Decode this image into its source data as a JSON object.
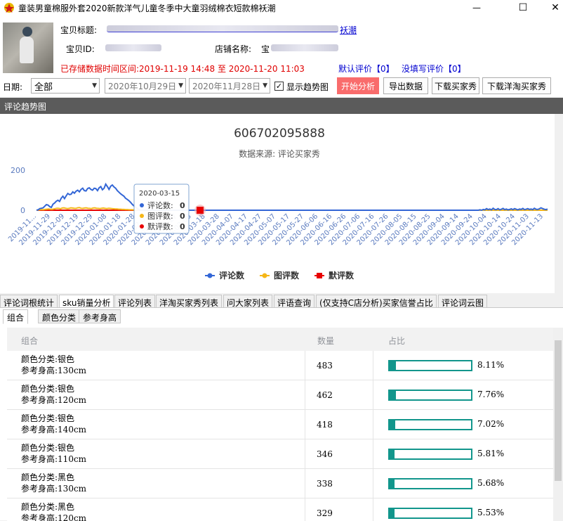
{
  "window": {
    "title": "童装男童棉服外套2020新款洋气儿童冬季中大童羽绒棉衣短款棉袄潮",
    "minimize": "—",
    "maximize": "☐",
    "close": "✕"
  },
  "product": {
    "title_label": "宝贝标题:",
    "title_value_tail": "袄潮",
    "id_label": "宝贝ID:",
    "shop_label": "店铺名称:",
    "shop_value_head": "宝",
    "stored_range_label": "已存储数据时间区间:",
    "stored_range_value": "2019-11-19 14:48 至 2020-11-20 11:03",
    "default_reviews": "默认评价【0】",
    "no_review": "没填写评价【0】"
  },
  "toolbar": {
    "date_label": "日期:",
    "range_select": "全部",
    "start_date": "2020年10月29日",
    "end_date": "2020年11月28日",
    "show_trend_label": "显示趋势图",
    "show_trend_checked": true,
    "analyze_btn": "开始分析",
    "export_btn": "导出数据",
    "download_buyer_btn": "下载买家秀",
    "download_global_btn": "下载洋淘买家秀"
  },
  "section_title": "评论趋势图",
  "chart_data": {
    "type": "line",
    "title": "606702095888",
    "subtitle": "数据来源: 评论买家秀",
    "ylim": [
      0,
      200
    ],
    "yticks": [
      "200",
      "0"
    ],
    "xticks": [
      "2019-11...",
      "2019-11-29",
      "2019-12-09",
      "2019-12-19",
      "2019-12-29",
      "2020-01-08",
      "2020-01-18",
      "2020-01-28",
      "2020-02-07",
      "2020-02-17",
      "2020-02-27",
      "2020-03-08",
      "2020-03-18",
      "2020-03-28",
      "2020-04-07",
      "2020-04-17",
      "2020-04-27",
      "2020-05-07",
      "2020-05-17",
      "2020-05-27",
      "2020-06-06",
      "2020-06-16",
      "2020-06-26",
      "2020-07-06",
      "2020-07-16",
      "2020-07-26",
      "2020-08-05",
      "2020-08-15",
      "2020-08-25",
      "2020-09-04",
      "2020-09-14",
      "2020-09-24",
      "2020-10-04",
      "2020-10-14",
      "2020-10-24",
      "2020-11-03",
      "2020-11-13"
    ],
    "series": [
      {
        "name": "评论数",
        "color": "#3366d6",
        "values": [
          0,
          2,
          8,
          10,
          12,
          20,
          28,
          26,
          18,
          14,
          30,
          36,
          45,
          50,
          44,
          60,
          70,
          58,
          72,
          84,
          78,
          80,
          92,
          85,
          95,
          100,
          92,
          104,
          110,
          98,
          96,
          108,
          112,
          104,
          100,
          110,
          108,
          98,
          112,
          118,
          102,
          110,
          130,
          118,
          104,
          120,
          126,
          116,
          110,
          98,
          90,
          82,
          76,
          70,
          60,
          54,
          48,
          40,
          30,
          22,
          16,
          10,
          4,
          0,
          0,
          0,
          0,
          0,
          0,
          0,
          0,
          0,
          0,
          0,
          0,
          0,
          0,
          0,
          0,
          0,
          0,
          0,
          0,
          0,
          0,
          0,
          0,
          0,
          0,
          0,
          0,
          0,
          0,
          0,
          0,
          0,
          0,
          0,
          0,
          0,
          0,
          0,
          0,
          0,
          0,
          0,
          0,
          0,
          0,
          0,
          0,
          0,
          0,
          0,
          0,
          0,
          0,
          0,
          0,
          0,
          0,
          0,
          0,
          0,
          0,
          0,
          0,
          0,
          0,
          0,
          0,
          0,
          0,
          0,
          0,
          0,
          0,
          0,
          0,
          0,
          0,
          0,
          0,
          0,
          0,
          0,
          0,
          0,
          0,
          0,
          0,
          0,
          0,
          0,
          0,
          0,
          0,
          0,
          0,
          0,
          0,
          0,
          0,
          0,
          0,
          0,
          0,
          0,
          0,
          0,
          0,
          0,
          0,
          0,
          0,
          0,
          0,
          0,
          0,
          0,
          0,
          0,
          0,
          0,
          0,
          0,
          0,
          0,
          0,
          0,
          0,
          0,
          0,
          0,
          0,
          0,
          0,
          0,
          0,
          0,
          0,
          0,
          0,
          0,
          0,
          0,
          0,
          0,
          0,
          0,
          0,
          0,
          0,
          0,
          0,
          0,
          0,
          0,
          0,
          0,
          0,
          0,
          0,
          0,
          0,
          0,
          0,
          0,
          0,
          0,
          0,
          0,
          0,
          0,
          0,
          0,
          0,
          0,
          0,
          0,
          0,
          0,
          0,
          0,
          0,
          0,
          0,
          0,
          0,
          0,
          0,
          0,
          0,
          0,
          0,
          0,
          0,
          0,
          0,
          0,
          0,
          0,
          0,
          0,
          0,
          0,
          0,
          0,
          0,
          2,
          0,
          4,
          2,
          8,
          3,
          6,
          2,
          10,
          4,
          3,
          8,
          2,
          5,
          9,
          3,
          6,
          2,
          4,
          7,
          3,
          8,
          5,
          2,
          6,
          4,
          9,
          3,
          5,
          8,
          4,
          6,
          3,
          10,
          5,
          4,
          7,
          12,
          8,
          5,
          3,
          6
        ]
      },
      {
        "name": "图评数",
        "color": "#f5b617",
        "values": [
          0,
          1,
          2,
          3,
          2,
          4,
          5,
          6,
          5,
          4,
          6,
          8,
          10,
          9,
          7,
          11,
          12,
          10,
          8,
          9,
          12,
          11,
          10,
          9,
          12,
          13,
          10,
          9,
          11,
          12,
          10,
          9,
          8,
          11,
          12,
          10,
          9,
          8,
          10,
          11,
          9,
          8,
          10,
          9,
          8,
          7,
          6,
          6,
          5,
          5,
          4,
          4,
          3,
          3,
          2,
          2,
          2,
          1,
          1,
          1,
          0,
          0,
          0,
          0,
          0,
          0,
          0,
          0,
          0,
          0,
          0,
          0,
          0,
          0,
          0,
          0,
          0,
          0,
          0,
          0,
          0,
          0,
          0,
          0,
          0,
          0,
          0,
          0,
          0,
          0,
          0,
          0,
          0,
          0,
          0,
          0,
          0,
          0,
          0,
          0,
          0,
          0,
          0,
          0,
          0,
          0,
          0,
          0,
          0,
          0,
          0,
          0,
          0,
          0,
          0,
          0,
          0,
          0,
          0,
          0,
          0,
          0,
          0,
          0,
          0,
          0,
          0,
          0,
          0,
          0,
          0,
          0,
          0,
          0,
          0,
          0,
          0,
          0,
          0,
          0,
          0,
          0,
          0,
          0,
          0,
          0,
          0,
          0,
          0,
          0,
          0,
          0,
          0,
          0,
          0,
          0,
          0,
          0,
          0,
          0,
          0,
          0,
          0,
          0,
          0,
          0,
          0,
          0,
          0,
          0,
          0,
          0,
          0,
          0,
          0,
          0,
          0,
          0,
          0,
          0,
          0,
          0,
          0,
          0,
          0,
          0,
          0,
          0,
          0,
          0,
          0,
          0,
          0,
          0,
          0,
          0,
          0,
          0,
          0,
          0,
          0,
          0,
          0,
          0,
          0,
          0,
          0,
          0,
          0,
          0,
          0,
          0,
          0,
          0,
          0,
          0,
          0,
          0,
          0,
          0,
          0,
          0,
          0,
          0,
          0,
          0,
          0,
          0,
          0,
          0,
          0,
          0,
          0,
          0,
          0,
          0,
          0,
          0,
          0,
          0,
          0,
          0,
          0,
          0,
          0,
          0,
          0,
          0,
          0,
          0,
          0,
          0,
          0,
          0,
          0,
          0,
          0,
          0,
          0,
          0,
          0,
          0,
          0,
          0,
          0,
          0,
          0,
          0,
          0,
          0,
          0,
          0,
          0,
          0,
          0,
          0,
          0,
          0,
          0,
          0,
          0,
          0,
          0,
          0,
          0,
          0,
          0,
          0,
          0,
          0,
          0,
          0,
          0,
          0,
          0,
          0,
          0,
          0,
          0
        ]
      },
      {
        "name": "默评数",
        "color": "#e80000",
        "values": [
          0
        ]
      }
    ],
    "legend": [
      "评论数",
      "图评数",
      "默评数"
    ],
    "legend_position": "bottom",
    "grid": false,
    "tooltip": {
      "date": "2020-03-15",
      "rows": [
        {
          "label": "评论数:",
          "value": "0",
          "color": "#3366d6"
        },
        {
          "label": "图评数:",
          "value": "0",
          "color": "#f5b617"
        },
        {
          "label": "默评数:",
          "value": "0",
          "color": "#e80000"
        }
      ]
    }
  },
  "tabs": [
    "评论词根统计",
    "sku销量分析",
    "评论列表",
    "洋淘买家秀列表",
    "问大家列表",
    "评语查询",
    "(仅支持C店分析)买家信誉占比",
    "评论词云图"
  ],
  "active_tab": 1,
  "subtabs": [
    "组合",
    "颜色分类",
    "参考身高"
  ],
  "active_subtab": 0,
  "table": {
    "headers": [
      "组合",
      "数量",
      "占比"
    ],
    "rows": [
      {
        "line1": "颜色分类:银色",
        "line2": "参考身高:130cm",
        "qty": "483",
        "pct": "8.11%",
        "ratio": 0.0811
      },
      {
        "line1": "颜色分类:银色",
        "line2": "参考身高:120cm",
        "qty": "462",
        "pct": "7.76%",
        "ratio": 0.0776
      },
      {
        "line1": "颜色分类:银色",
        "line2": "参考身高:140cm",
        "qty": "418",
        "pct": "7.02%",
        "ratio": 0.0702
      },
      {
        "line1": "颜色分类:银色",
        "line2": "参考身高:110cm",
        "qty": "346",
        "pct": "5.81%",
        "ratio": 0.0581
      },
      {
        "line1": "颜色分类:黑色",
        "line2": "参考身高:130cm",
        "qty": "338",
        "pct": "5.68%",
        "ratio": 0.0568
      },
      {
        "line1": "颜色分类:黑色",
        "line2": "参考身高:120cm",
        "qty": "329",
        "pct": "5.53%",
        "ratio": 0.0553
      }
    ]
  }
}
